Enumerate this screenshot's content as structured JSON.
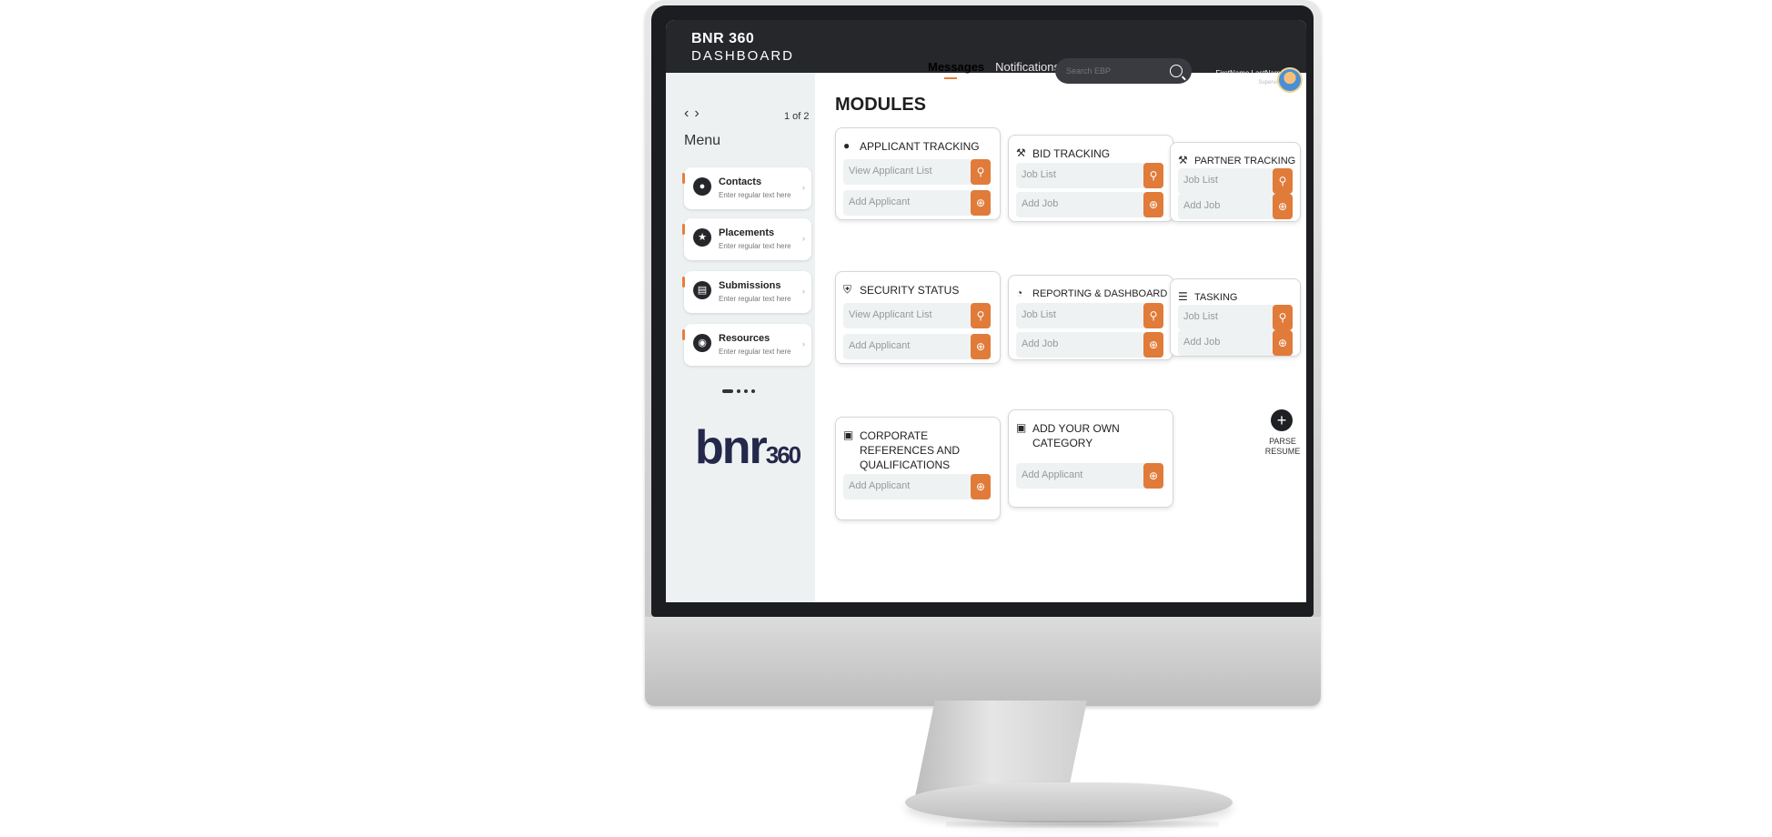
{
  "brand": {
    "title": "BNR 360",
    "subtitle": "DASHBOARD"
  },
  "topnav": {
    "messages": "Messages",
    "notifications": "Notifications"
  },
  "search": {
    "placeholder": "Search EBP"
  },
  "user": {
    "name": "FirstName LastName",
    "role": "Supervisor"
  },
  "sidebar": {
    "page_count": "1 of 2",
    "menu_title": "Menu",
    "items": [
      {
        "label": "Contacts",
        "sub": "Enter regular text here",
        "icon": "user-icon"
      },
      {
        "label": "Placements",
        "sub": "Enter regular text here",
        "icon": "star-icon"
      },
      {
        "label": "Submissions",
        "sub": "Enter regular text here",
        "icon": "document-icon"
      },
      {
        "label": "Resources",
        "sub": "Enter regular text here",
        "icon": "people-icon"
      }
    ],
    "logo": "bnr",
    "logo_num": "360"
  },
  "main": {
    "title": "MODULES",
    "modules": [
      {
        "title": "APPLICANT TRACKING",
        "icon": "person-icon",
        "rows": [
          "View Applicant List",
          "Add Applicant"
        ]
      },
      {
        "title": "BID TRACKING",
        "icon": "gavel-icon",
        "rows": [
          "Job List",
          "Add Job"
        ]
      },
      {
        "title": "PARTNER TRACKING",
        "icon": "gavel-icon",
        "rows": [
          "Job List",
          "Add Job"
        ]
      },
      {
        "title": "SECURITY STATUS",
        "icon": "shield-icon",
        "rows": [
          "View Applicant List",
          "Add Applicant"
        ]
      },
      {
        "title": "REPORTING & DASHBOARD",
        "icon": "pie-icon",
        "rows": [
          "Job List",
          "Add Job"
        ]
      },
      {
        "title": "TASKING",
        "icon": "tasks-icon",
        "rows": [
          "Job List",
          "Add Job"
        ]
      },
      {
        "title": "CORPORATE REFERENCES AND QUALIFICATIONS",
        "icon": "briefcase-icon",
        "rows": [
          "Add Applicant"
        ]
      },
      {
        "title": "ADD YOUR OWN CATEGORY",
        "icon": "briefcase-icon",
        "rows": [
          "Add Applicant"
        ]
      }
    ],
    "parse": {
      "label_line1": "PARSE",
      "label_line2": "RESUME"
    }
  },
  "colors": {
    "accent": "#e07b3a",
    "dark": "#26272b",
    "sidebar_bg": "#eef1f2"
  }
}
